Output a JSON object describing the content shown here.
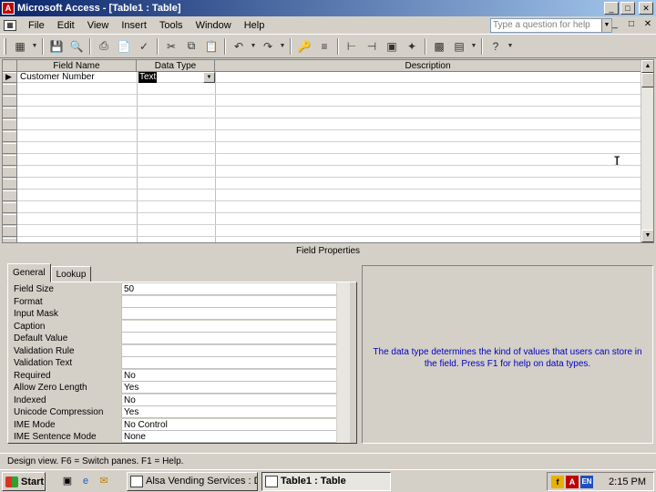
{
  "window": {
    "title": "Microsoft Access - [Table1 : Table]",
    "app_icon": "access-key-icon"
  },
  "menu": {
    "items": [
      "File",
      "Edit",
      "View",
      "Insert",
      "Tools",
      "Window",
      "Help"
    ],
    "ask_placeholder": "Type a question for help"
  },
  "toolbar": {
    "buttons": [
      "view-icon",
      "save-icon",
      "search-icon",
      "print-icon",
      "print-preview-icon",
      "spelling-icon",
      "cut-icon",
      "copy-icon",
      "paste-icon",
      "undo-icon",
      "redo-icon",
      "primary-key-icon",
      "indexes-icon",
      "insert-rows-icon",
      "delete-rows-icon",
      "properties-icon",
      "build-icon",
      "database-window-icon",
      "new-object-icon",
      "help-icon"
    ]
  },
  "design_grid": {
    "columns": [
      "Field Name",
      "Data Type",
      "Description"
    ],
    "rows": [
      {
        "field_name": "Customer Number",
        "data_type": "Text",
        "description": ""
      }
    ],
    "empty_rows": 14
  },
  "field_properties": {
    "title": "Field Properties",
    "tabs": [
      "General",
      "Lookup"
    ],
    "active_tab": "General",
    "properties": [
      {
        "label": "Field Size",
        "value": "50"
      },
      {
        "label": "Format",
        "value": ""
      },
      {
        "label": "Input Mask",
        "value": ""
      },
      {
        "label": "Caption",
        "value": ""
      },
      {
        "label": "Default Value",
        "value": ""
      },
      {
        "label": "Validation Rule",
        "value": ""
      },
      {
        "label": "Validation Text",
        "value": ""
      },
      {
        "label": "Required",
        "value": "No"
      },
      {
        "label": "Allow Zero Length",
        "value": "Yes"
      },
      {
        "label": "Indexed",
        "value": "No"
      },
      {
        "label": "Unicode Compression",
        "value": "Yes"
      },
      {
        "label": "IME Mode",
        "value": "No Control"
      },
      {
        "label": "IME Sentence Mode",
        "value": "None"
      }
    ],
    "help_text": "The data type determines the kind of values that users can store in the field.  Press F1 for help on data types."
  },
  "status_bar": {
    "text": "Design view.  F6 = Switch panes.  F1 = Help."
  },
  "taskbar": {
    "start_label": "Start",
    "tasks": [
      {
        "label": "Alsa Vending Services : D...",
        "active": false
      },
      {
        "label": "Table1 : Table",
        "active": true
      }
    ],
    "tray_lang": "EN",
    "clock": "2:15 PM"
  }
}
